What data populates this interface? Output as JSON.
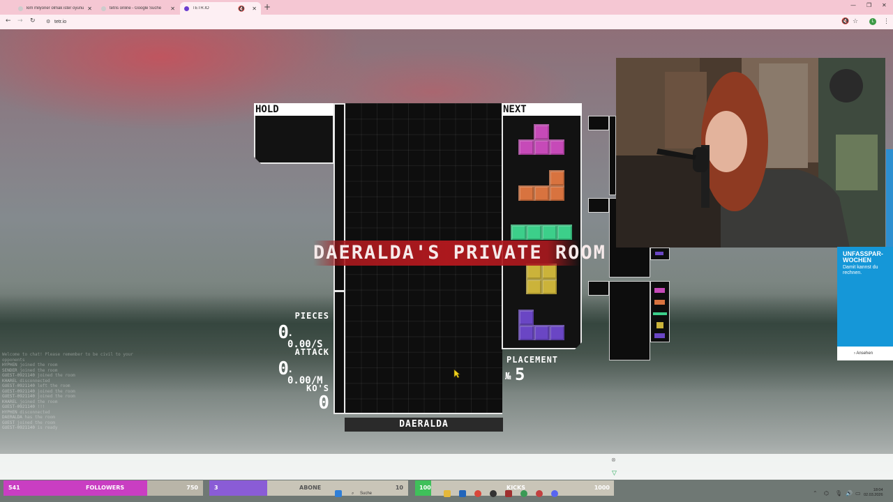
{
  "browser": {
    "tabs": [
      {
        "label": "kim milyoner olmak ister oyunu",
        "active": false
      },
      {
        "label": "tetris online - Google Suche",
        "active": false
      },
      {
        "label": "TETR.IO",
        "active": true
      }
    ],
    "url": "tetr.io"
  },
  "game": {
    "hold_label": "HOLD",
    "next_label": "NEXT",
    "room_title": "DAERALDA'S PRIVATE ROOM",
    "player_name": "DAERALDA",
    "stats": {
      "pieces_label": "PIECES",
      "pieces_value": "0",
      "pieces_rate": ". 0.00/S",
      "attack_label": "ATTACK",
      "attack_value": "0",
      "attack_rate": ". 0.00/M",
      "kos_label": "KO'S",
      "kos_value": "0",
      "placement_label": "PLACEMENT",
      "placement_prefix": "№",
      "placement_value": "5"
    },
    "next_queue": [
      {
        "piece": "T",
        "color": "#c64ab8"
      },
      {
        "piece": "L",
        "color": "#d8733f"
      },
      {
        "piece": "I",
        "color": "#3ccf8a"
      },
      {
        "piece": "O",
        "color": "#cbb33a"
      },
      {
        "piece": "J",
        "color": "#6a46c4"
      }
    ]
  },
  "ad": {
    "title": "UNFASSPAR-WOCHEN",
    "subtitle": "Damit kannst du rechnen.",
    "button": "Ansehen"
  },
  "stream_bars": [
    {
      "count": "541",
      "label": "FOLLOWERS",
      "goal": "750",
      "color": "#c93ec2",
      "progress": 0.72
    },
    {
      "count": "3",
      "label": "ABONE",
      "goal": "10",
      "color": "#8a5cd6",
      "progress": 0.3
    },
    {
      "count": "100",
      "label": "KICKS",
      "goal": "1000",
      "color": "#3fc05a",
      "progress": 0.1
    }
  ],
  "taskbar": {
    "search": "Suche",
    "time": "18:04",
    "date": "02.03.2026"
  }
}
